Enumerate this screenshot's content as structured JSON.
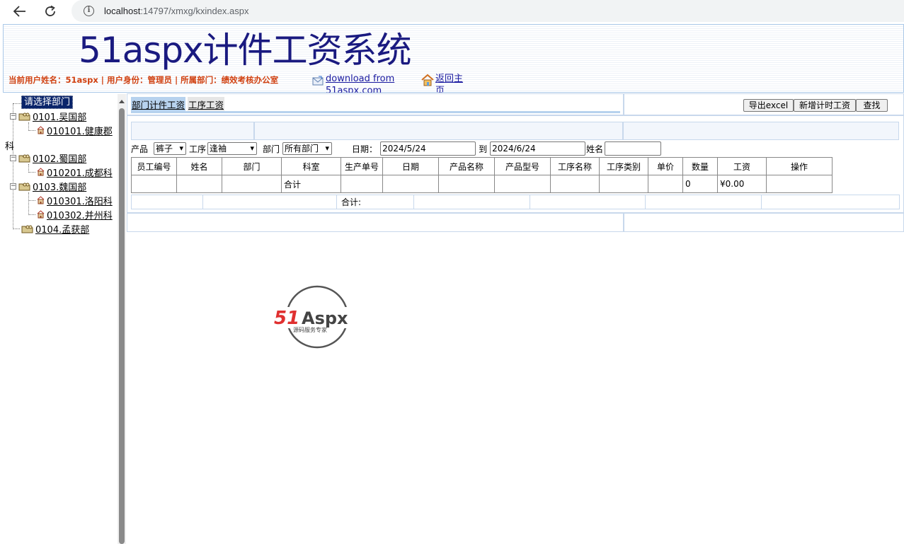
{
  "browser": {
    "url_host": "localhost",
    "url_rest": ":14797/xmxg/kxindex.aspx"
  },
  "header": {
    "title": "51aspx计件工资系统",
    "user_info": "当前用户姓名：51aspx | 用户身份：管理员 | 所属部门：绩效考核办公室",
    "download_link": "download from 51aspx.com",
    "home_link": "返回主页"
  },
  "tree": {
    "root": "请选择部门",
    "wrap_fragment": "科",
    "nodes": [
      {
        "label": "0101.吴国部"
      },
      {
        "label": "010101.健康郡"
      },
      {
        "label": "0102.蜀国部"
      },
      {
        "label": "010201.成都科"
      },
      {
        "label": "0103.魏国部"
      },
      {
        "label": "010301.洛阳科"
      },
      {
        "label": "010302.并州科"
      },
      {
        "label": "0104.孟获部"
      }
    ]
  },
  "tabs": [
    {
      "label": "部门计件工资"
    },
    {
      "label": "工序工资"
    }
  ],
  "toolbar": {
    "export": "导出excel",
    "add": "新增计时工资",
    "search": "查找"
  },
  "filters": {
    "product_label": "产品",
    "product_value": "裤子",
    "process_label": "工序",
    "process_value": "逢袖",
    "dept_label": "部门",
    "dept_value": "所有部门",
    "date_label": "日期：",
    "date_from": "2024/5/24",
    "to_label": "到",
    "date_to": "2024/6/24",
    "name_label": "姓名",
    "name_value": ""
  },
  "table": {
    "columns": [
      "员工编号",
      "姓名",
      "部门",
      "科室",
      "生产单号",
      "日期",
      "产品名称",
      "产品型号",
      "工序名称",
      "工序类别",
      "单价",
      "数量",
      "工资",
      "操作"
    ],
    "total_row": {
      "label": "合计",
      "quantity": "0",
      "wage": "¥0.00"
    }
  },
  "summary": {
    "label": "合计:"
  },
  "logo": {
    "brand_a": "51",
    "brand_b": "Aspx",
    "tagline": "源码服务专家"
  }
}
